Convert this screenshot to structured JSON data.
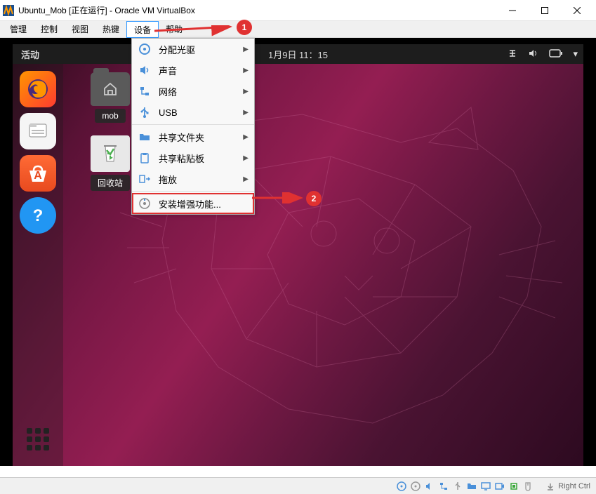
{
  "titlebar": {
    "text": "Ubuntu_Mob [正在运行] - Oracle VM VirtualBox"
  },
  "menubar": {
    "items": [
      "管理",
      "控制",
      "视图",
      "热键",
      "设备",
      "帮助"
    ],
    "active_index": 4
  },
  "annotations": {
    "badge1": "1",
    "badge2": "2"
  },
  "ubuntu": {
    "activities": "活动",
    "clock": "1月9日  11：15",
    "desktop": {
      "folder_label": "mob",
      "trash_label": "回收站"
    }
  },
  "dropdown": {
    "items": [
      {
        "icon": "disc",
        "label": "分配光驱",
        "submenu": true
      },
      {
        "icon": "audio",
        "label": "声音",
        "submenu": true
      },
      {
        "icon": "network",
        "label": "网络",
        "submenu": true
      },
      {
        "icon": "usb",
        "label": "USB",
        "submenu": true
      },
      {
        "sep": true
      },
      {
        "icon": "folder",
        "label": "共享文件夹",
        "submenu": true
      },
      {
        "icon": "clipboard",
        "label": "共享粘贴板",
        "submenu": true
      },
      {
        "icon": "drag",
        "label": "拖放",
        "submenu": true
      },
      {
        "sep": true
      },
      {
        "icon": "install",
        "label": "安装增强功能...",
        "submenu": false,
        "highlight": true
      }
    ]
  },
  "statusbar": {
    "host_key": "Right Ctrl"
  }
}
